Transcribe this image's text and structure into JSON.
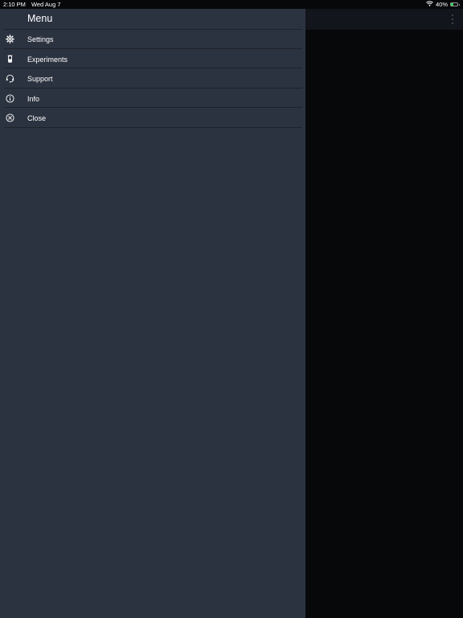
{
  "status_bar": {
    "time": "2:10 PM",
    "date": "Wed Aug 7",
    "battery_percent": "40%",
    "battery_level": 0.4,
    "wifi_icon": "wifi-icon",
    "battery_icon": "battery-charging-icon"
  },
  "drawer": {
    "title": "Menu",
    "items": [
      {
        "label": "Settings",
        "icon": "gear-icon"
      },
      {
        "label": "Experiments",
        "icon": "beaker-icon"
      },
      {
        "label": "Support",
        "icon": "headset-icon"
      },
      {
        "label": "Info",
        "icon": "info-icon"
      },
      {
        "label": "Close",
        "icon": "close-circle-icon"
      }
    ]
  },
  "colors": {
    "drawer_bg": "#2c3340",
    "background": "#07080a",
    "divider": "#1d222b",
    "text": "#ffffff",
    "battery_fill": "#2fd158"
  }
}
